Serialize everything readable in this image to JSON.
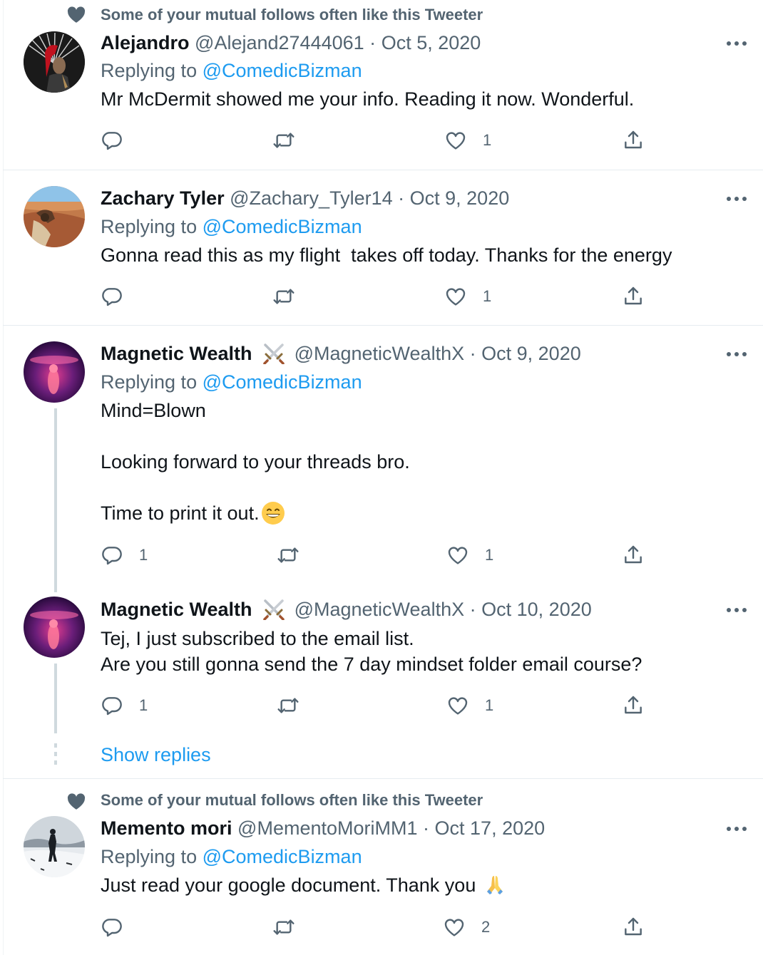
{
  "social_context": "Some of your mutual follows often like this Tweeter",
  "replying_label": "Replying to",
  "colors": {
    "link": "#1d9bf0",
    "muted": "#536471",
    "text": "#0f1419",
    "thread": "#cfd9de"
  },
  "tweets": [
    {
      "name": "Alejandro",
      "handle": "@Alejand27444061",
      "sep": "·",
      "date": "Oct 5, 2020",
      "mention": "@ComedicBizman",
      "text": "Mr McDermit showed me your info. Reading it now. Wonderful.",
      "reply_count": "",
      "like_count": "1"
    },
    {
      "name": "Zachary Tyler",
      "handle": "@Zachary_Tyler14",
      "sep": "·",
      "date": "Oct 9, 2020",
      "mention": "@ComedicBizman",
      "text": "Gonna read this as my flight  takes off today. Thanks for the energy",
      "reply_count": "",
      "like_count": "1"
    },
    {
      "name": "Magnetic Wealth",
      "handle": "@MagneticWealthX",
      "sep": "·",
      "date": "Oct 9, 2020",
      "mention": "@ComedicBizman",
      "text": "Mind=Blown\n\nLooking forward to your threads bro.\n\nTime to print it out.",
      "reply_count": "1",
      "like_count": "1"
    },
    {
      "name": "Magnetic Wealth",
      "handle": "@MagneticWealthX",
      "sep": "·",
      "date": "Oct 10, 2020",
      "text": "Tej, I just subscribed to the email list.\nAre you still gonna send the 7 day mindset folder email course?",
      "reply_count": "1",
      "like_count": "1"
    },
    {
      "name": "Memento mori",
      "handle": "@MementoMoriMM1",
      "sep": "·",
      "date": "Oct 17, 2020",
      "mention": "@ComedicBizman",
      "text": "Just read your google document. Thank you",
      "reply_count": "",
      "like_count": "2"
    }
  ],
  "show_replies": "Show replies"
}
